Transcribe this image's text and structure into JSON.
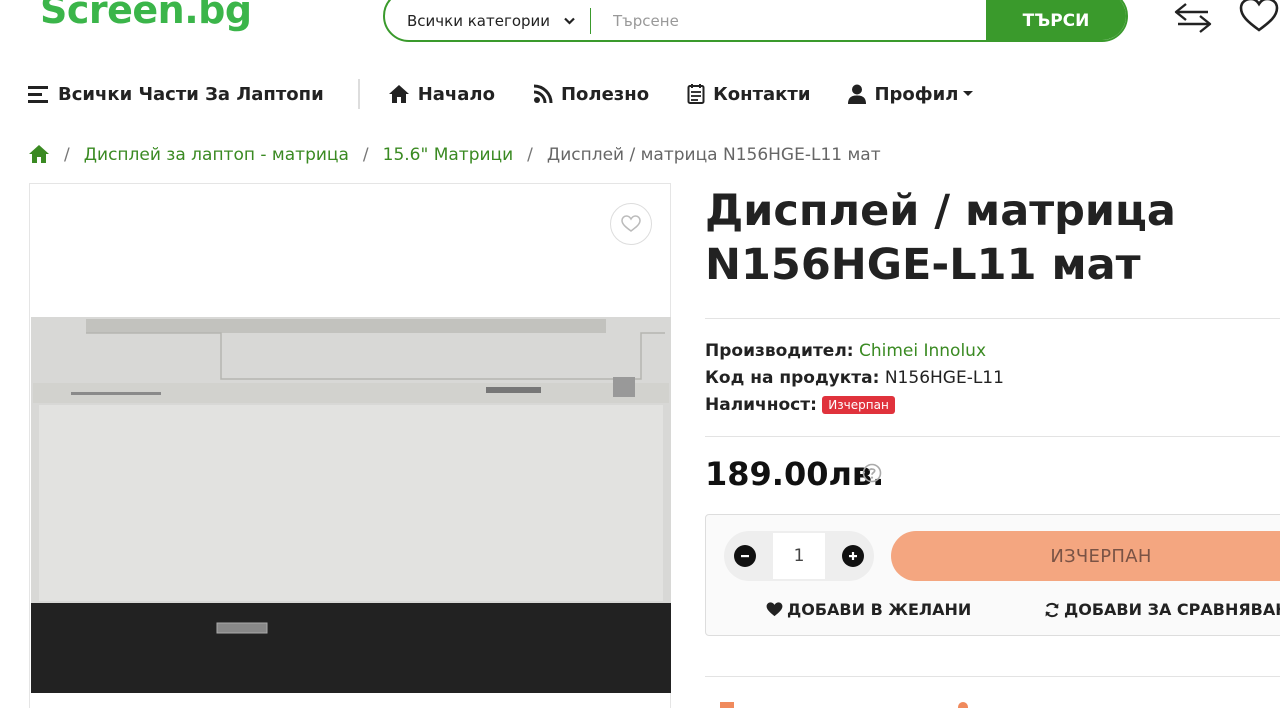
{
  "header": {
    "logo": "Screen.bg",
    "category_select": "Всички категории",
    "search_placeholder": "Търсене",
    "search_button": "ТЪРСИ"
  },
  "nav": {
    "all_parts": "Всички Части За Лаптопи",
    "items": [
      {
        "label": "Начало",
        "icon": "home-icon"
      },
      {
        "label": "Полезно",
        "icon": "blog-icon"
      },
      {
        "label": "Контакти",
        "icon": "contacts-icon"
      },
      {
        "label": "Профил",
        "icon": "user-icon"
      }
    ]
  },
  "breadcrumb": {
    "items": [
      "Дисплей за лаптоп - матрица",
      "15.6\" Матрици"
    ],
    "current": "Дисплей / матрица N156HGE-L11 мат"
  },
  "product": {
    "title_line1": "Дисплей / матрица",
    "title_line2": "N156HGE-L11 мат",
    "manufacturer_label": "Производител:",
    "manufacturer": "Chimei Innolux",
    "code_label": "Код на продукта:",
    "code": "N156HGE-L11",
    "availability_label": "Наличност:",
    "availability": "Изчерпан",
    "price": "189.00лв.",
    "quantity": "1",
    "out_of_stock_button": "ИЗЧЕРПАН",
    "add_wishlist": "ДОБАВИ В ЖЕЛАНИ",
    "add_compare": "ДОБАВИ ЗА СРАВНЯВАНЕ"
  },
  "colors": {
    "brand_green": "#3a9a2c",
    "logo_green": "#3bb54a",
    "link_green": "#3a8a22",
    "out_badge": "#e0323c",
    "out_button": "#f4a680"
  }
}
